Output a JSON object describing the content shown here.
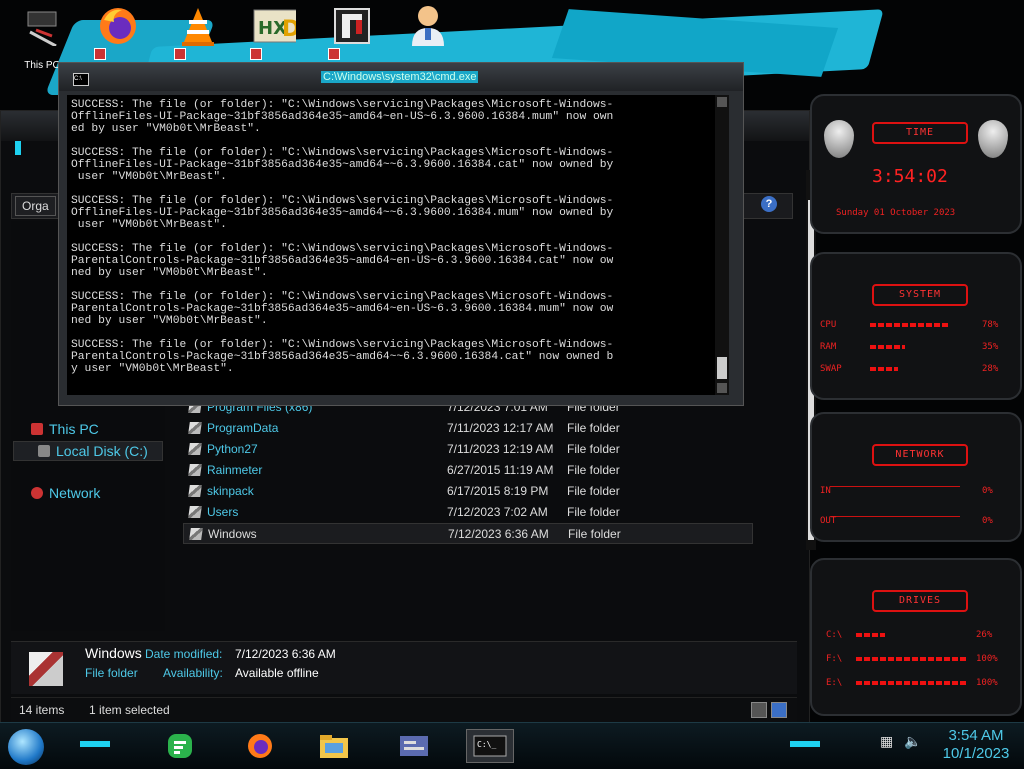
{
  "desktop": {
    "icons": [
      {
        "label": "This PC",
        "icon": "this-pc-icon"
      },
      {
        "label": "",
        "icon": "firefox-icon"
      },
      {
        "label": "",
        "icon": "vlc-icon"
      },
      {
        "label": "",
        "icon": "hxd-icon"
      },
      {
        "label": "",
        "icon": "app-shortcut-icon"
      },
      {
        "label": "",
        "icon": "user-doctor-icon"
      }
    ],
    "this_pc_label": "This PC"
  },
  "cmd": {
    "title": "C:\\Windows\\system32\\cmd.exe",
    "icon_text": "C:\\",
    "lines": [
      "SUCCESS: The file (or folder): \"C:\\Windows\\servicing\\Packages\\Microsoft-Windows-",
      "OfflineFiles-UI-Package~31bf3856ad364e35~amd64~en-US~6.3.9600.16384.mum\" now own",
      "ed by user \"VM0b0t\\MrBeast\".",
      "",
      "SUCCESS: The file (or folder): \"C:\\Windows\\servicing\\Packages\\Microsoft-Windows-",
      "OfflineFiles-UI-Package~31bf3856ad364e35~amd64~~6.3.9600.16384.cat\" now owned by",
      " user \"VM0b0t\\MrBeast\".",
      "",
      "SUCCESS: The file (or folder): \"C:\\Windows\\servicing\\Packages\\Microsoft-Windows-",
      "OfflineFiles-UI-Package~31bf3856ad364e35~amd64~~6.3.9600.16384.mum\" now owned by",
      " user \"VM0b0t\\MrBeast\".",
      "",
      "SUCCESS: The file (or folder): \"C:\\Windows\\servicing\\Packages\\Microsoft-Windows-",
      "ParentalControls-Package~31bf3856ad364e35~amd64~en-US~6.3.9600.16384.cat\" now ow",
      "ned by user \"VM0b0t\\MrBeast\".",
      "",
      "SUCCESS: The file (or folder): \"C:\\Windows\\servicing\\Packages\\Microsoft-Windows-",
      "ParentalControls-Package~31bf3856ad364e35~amd64~en-US~6.3.9600.16384.mum\" now ow",
      "ned by user \"VM0b0t\\MrBeast\".",
      "",
      "SUCCESS: The file (or folder): \"C:\\Windows\\servicing\\Packages\\Microsoft-Windows-",
      "ParentalControls-Package~31bf3856ad364e35~amd64~~6.3.9600.16384.cat\" now owned b",
      "y user \"VM0b0t\\MrBeast\"."
    ]
  },
  "explorer": {
    "organize_label": "Orga",
    "help_label": "?",
    "nav": {
      "this_pc": "This PC",
      "local_disk": "Local Disk (C:)",
      "network": "Network"
    },
    "files": [
      {
        "name": "Program Files (x86)",
        "date": "7/12/2023 7:01 AM",
        "type": "File folder"
      },
      {
        "name": "ProgramData",
        "date": "7/11/2023 12:17 AM",
        "type": "File folder"
      },
      {
        "name": "Python27",
        "date": "7/11/2023 12:19 AM",
        "type": "File folder"
      },
      {
        "name": "Rainmeter",
        "date": "6/27/2015 11:19 AM",
        "type": "File folder"
      },
      {
        "name": "skinpack",
        "date": "6/17/2015 8:19 PM",
        "type": "File folder"
      },
      {
        "name": "Users",
        "date": "7/12/2023 7:02 AM",
        "type": "File folder"
      },
      {
        "name": "Windows",
        "date": "7/12/2023 6:36 AM",
        "type": "File folder"
      }
    ],
    "details": {
      "name": "Windows",
      "type": "File folder",
      "date_modified_label": "Date modified:",
      "date_modified": "7/12/2023 6:36 AM",
      "availability_label": "Availability:",
      "availability": "Available offline"
    },
    "status": {
      "items": "14 items",
      "selected": "1 item selected"
    }
  },
  "gadgets": {
    "time": {
      "title": "TIME",
      "clock": "3:54:02",
      "date": "Sunday 01 October 2023"
    },
    "system": {
      "title": "SYSTEM",
      "rows": [
        {
          "label": "CPU",
          "value": "78%",
          "level": 0.78
        },
        {
          "label": "RAM",
          "value": "35%",
          "level": 0.35
        },
        {
          "label": "SWAP",
          "value": "28%",
          "level": 0.28
        }
      ]
    },
    "network": {
      "title": "NETWORK",
      "rows": [
        {
          "label": "IN",
          "value": "0%"
        },
        {
          "label": "OUT",
          "value": "0%"
        }
      ]
    },
    "drives": {
      "title": "DRIVES",
      "rows": [
        {
          "label": "C:\\",
          "value": "26%",
          "level": 0.26
        },
        {
          "label": "F:\\",
          "value": "100%",
          "level": 1.0
        },
        {
          "label": "E:\\",
          "value": "100%",
          "level": 1.0
        }
      ]
    }
  },
  "taskbar": {
    "apps": [
      "feedly-icon",
      "firefox-icon",
      "file-explorer-icon",
      "control-panel-icon",
      "cmd-icon"
    ],
    "clock_time": "3:54 AM",
    "clock_date": "10/1/2023"
  },
  "colors": {
    "accent_cyan": "#1ed1f0",
    "link_blue": "#4ec9e8",
    "gadget_red": "#e22222"
  }
}
